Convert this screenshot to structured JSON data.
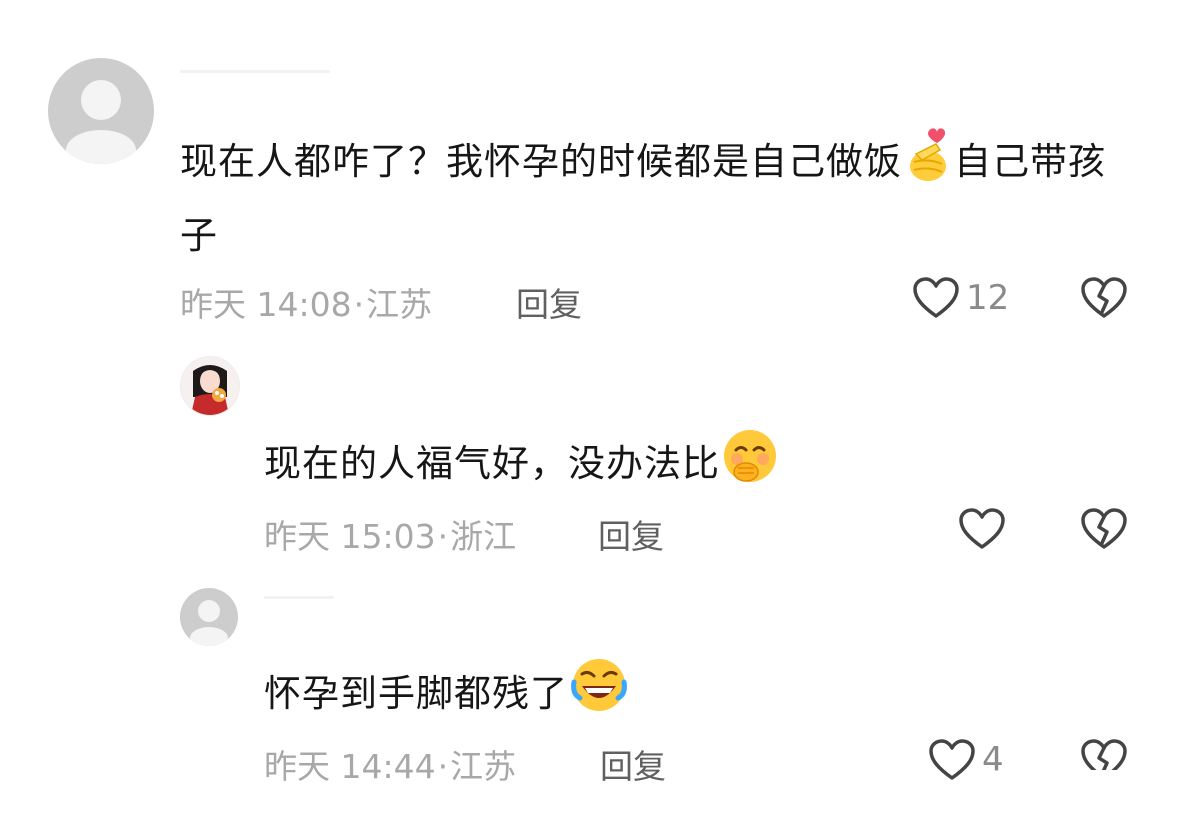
{
  "comments": [
    {
      "text_part1": "现在人都咋了？我怀孕的时候都是自己做饭",
      "emoji": "finger-heart-emoji",
      "text_part2": "自己带孩子",
      "time": "昨天 14:08",
      "location": "江苏",
      "reply_label": "回复",
      "like_count": "12"
    },
    {
      "text": "现在的人福气好，没办法比",
      "emoji": "shy-smiling-face-emoji",
      "time": "昨天 15:03",
      "location": "浙江",
      "reply_label": "回复",
      "like_count": ""
    },
    {
      "text": "怀孕到手脚都残了",
      "emoji": "rolling-laughing-face-emoji",
      "time": "昨天 14:44",
      "location": "江苏",
      "reply_label": "回复",
      "like_count": "4"
    }
  ],
  "meta_separator": "·",
  "colors": {
    "meta_text": "#a8a8a8",
    "reply_text": "#606060",
    "comment_text": "#161616",
    "icon_stroke": "#444444"
  }
}
